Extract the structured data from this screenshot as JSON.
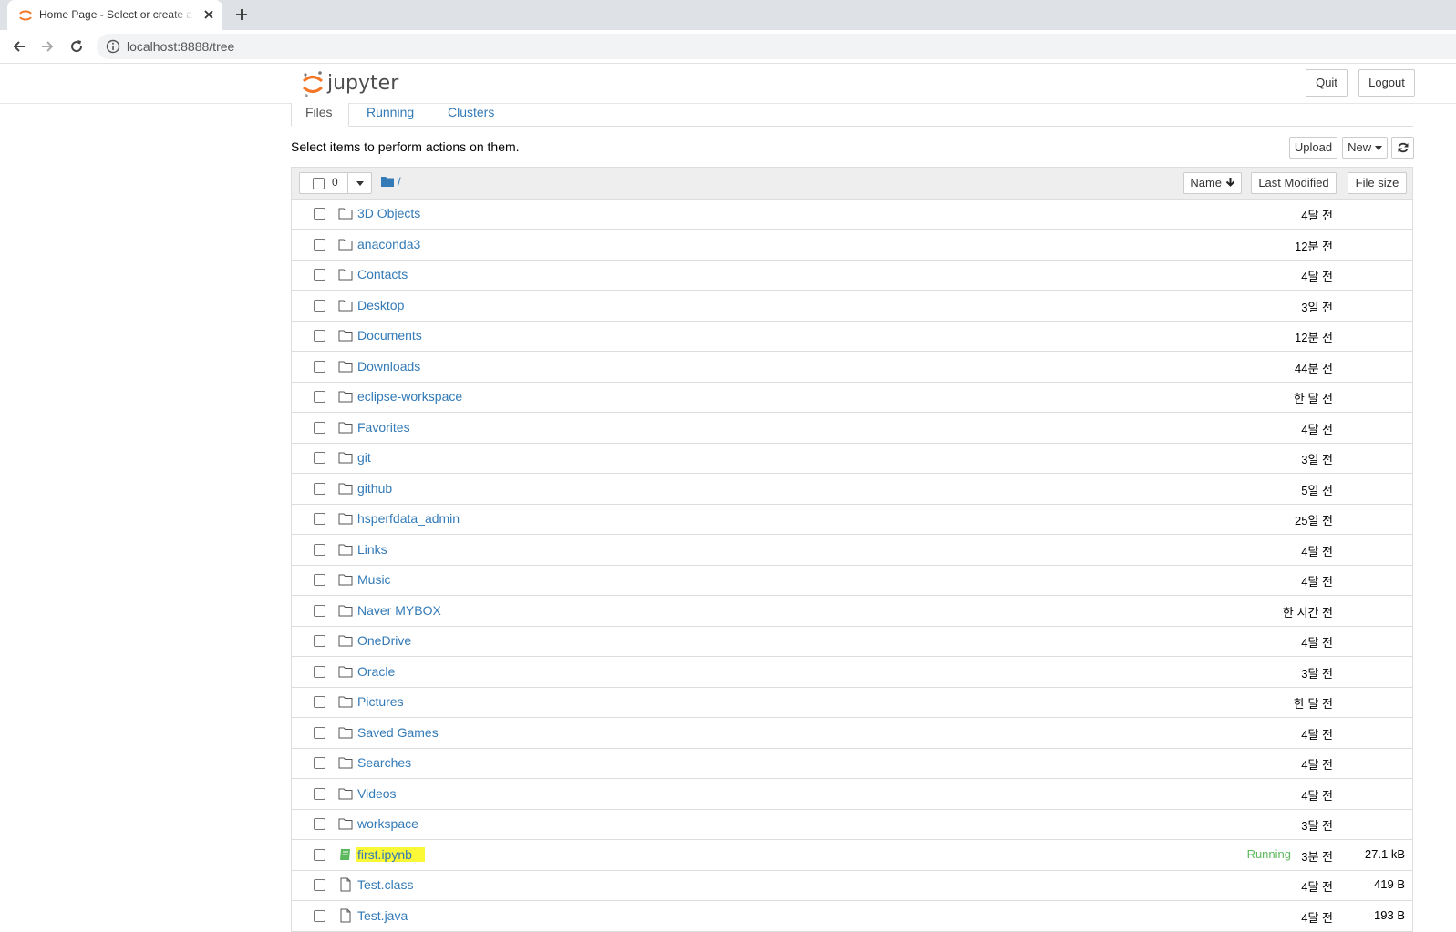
{
  "browser": {
    "tab_title": "Home Page - Select or create a",
    "url": "localhost:8888/tree"
  },
  "header": {
    "logo_text": "jupyter",
    "quit_label": "Quit",
    "logout_label": "Logout"
  },
  "tabs": [
    "Files",
    "Running",
    "Clusters"
  ],
  "info_text": "Select items to perform actions on them.",
  "actions": {
    "upload": "Upload",
    "new": "New"
  },
  "list_header": {
    "selected_count": "0",
    "breadcrumb": "/",
    "name_col": "Name",
    "modified_col": "Last Modified",
    "size_col": "File size"
  },
  "files": [
    {
      "name": "3D Objects",
      "type": "folder",
      "modified": "4달 전",
      "size": "",
      "running": ""
    },
    {
      "name": "anaconda3",
      "type": "folder",
      "modified": "12분 전",
      "size": "",
      "running": ""
    },
    {
      "name": "Contacts",
      "type": "folder",
      "modified": "4달 전",
      "size": "",
      "running": ""
    },
    {
      "name": "Desktop",
      "type": "folder",
      "modified": "3일 전",
      "size": "",
      "running": ""
    },
    {
      "name": "Documents",
      "type": "folder",
      "modified": "12분 전",
      "size": "",
      "running": ""
    },
    {
      "name": "Downloads",
      "type": "folder",
      "modified": "44분 전",
      "size": "",
      "running": ""
    },
    {
      "name": "eclipse-workspace",
      "type": "folder",
      "modified": "한 달 전",
      "size": "",
      "running": ""
    },
    {
      "name": "Favorites",
      "type": "folder",
      "modified": "4달 전",
      "size": "",
      "running": ""
    },
    {
      "name": "git",
      "type": "folder",
      "modified": "3일 전",
      "size": "",
      "running": ""
    },
    {
      "name": "github",
      "type": "folder",
      "modified": "5일 전",
      "size": "",
      "running": ""
    },
    {
      "name": "hsperfdata_admin",
      "type": "folder",
      "modified": "25일 전",
      "size": "",
      "running": ""
    },
    {
      "name": "Links",
      "type": "folder",
      "modified": "4달 전",
      "size": "",
      "running": ""
    },
    {
      "name": "Music",
      "type": "folder",
      "modified": "4달 전",
      "size": "",
      "running": ""
    },
    {
      "name": "Naver MYBOX",
      "type": "folder",
      "modified": "한 시간 전",
      "size": "",
      "running": ""
    },
    {
      "name": "OneDrive",
      "type": "folder",
      "modified": "4달 전",
      "size": "",
      "running": ""
    },
    {
      "name": "Oracle",
      "type": "folder",
      "modified": "3달 전",
      "size": "",
      "running": ""
    },
    {
      "name": "Pictures",
      "type": "folder",
      "modified": "한 달 전",
      "size": "",
      "running": ""
    },
    {
      "name": "Saved Games",
      "type": "folder",
      "modified": "4달 전",
      "size": "",
      "running": ""
    },
    {
      "name": "Searches",
      "type": "folder",
      "modified": "4달 전",
      "size": "",
      "running": ""
    },
    {
      "name": "Videos",
      "type": "folder",
      "modified": "4달 전",
      "size": "",
      "running": ""
    },
    {
      "name": "workspace",
      "type": "folder",
      "modified": "3달 전",
      "size": "",
      "running": ""
    },
    {
      "name": "first.ipynb",
      "type": "notebook",
      "modified": "3분 전",
      "size": "27.1 kB",
      "running": "Running",
      "highlighted": true
    },
    {
      "name": "Test.class",
      "type": "file",
      "modified": "4달 전",
      "size": "419 B",
      "running": ""
    },
    {
      "name": "Test.java",
      "type": "file",
      "modified": "4달 전",
      "size": "193 B",
      "running": ""
    }
  ],
  "colors": {
    "link": "#337ab7",
    "running": "#5cb85c",
    "highlight": "#fbf837",
    "jupyter_orange": "#f37726"
  }
}
